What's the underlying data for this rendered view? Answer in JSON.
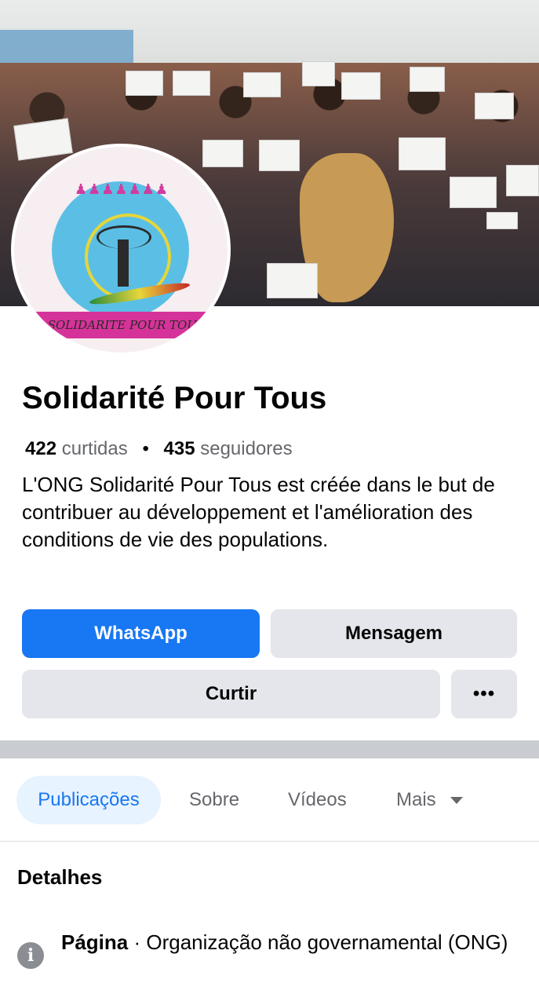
{
  "profile": {
    "name": "Solidarité Pour Tous",
    "avatar_ribbon": "SOLIDARITE POUR TOUS",
    "likes_count": "422",
    "likes_label": "curtidas",
    "followers_count": "435",
    "followers_label": "seguidores",
    "separator_dot": "•",
    "description": "L'ONG Solidarité Pour Tous est créée dans le but de contribuer au développement et l'amélioration  des conditions de vie des populations."
  },
  "actions": {
    "whatsapp_label": "WhatsApp",
    "message_label": "Mensagem",
    "like_label": "Curtir",
    "more_label": "•••"
  },
  "tabs": {
    "posts": "Publicações",
    "about": "Sobre",
    "videos": "Vídeos",
    "more": "Mais"
  },
  "details": {
    "title": "Detalhes",
    "category_label": "Página",
    "category_value": " · Organização não governamental (ONG)",
    "info_icon_glyph": "i"
  },
  "colors": {
    "primary_blue": "#1877f2",
    "secondary_button": "#e4e6eb",
    "active_tab_bg": "#e7f3ff",
    "muted_text": "#65676b",
    "logo_ribbon": "#d6339a"
  },
  "icons": {
    "info": "info-circle-icon",
    "caret": "caret-down-icon",
    "more": "more-horizontal-icon"
  }
}
